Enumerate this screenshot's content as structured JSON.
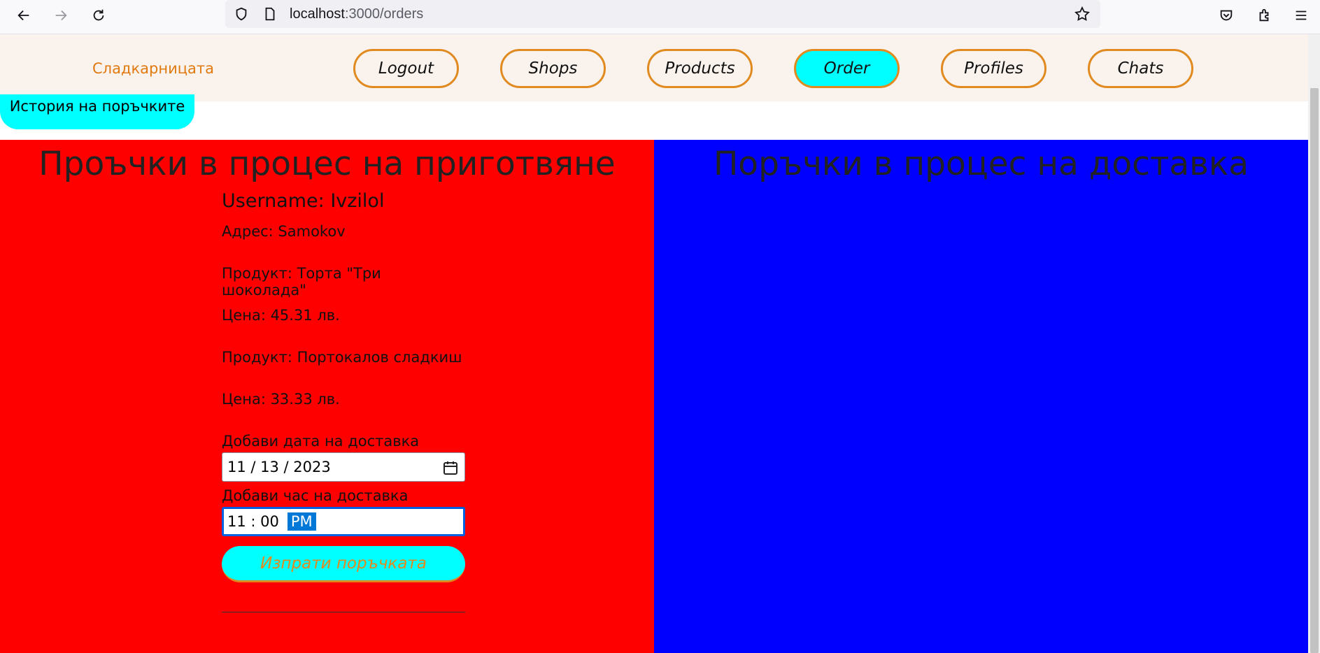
{
  "browser": {
    "url_host": "localhost",
    "url_path": ":3000/orders"
  },
  "nav": {
    "brand": "Сладкарницата",
    "buttons": [
      "Logout",
      "Shops",
      "Products",
      "Order",
      "Profiles",
      "Chats"
    ],
    "active": "Order"
  },
  "history_button": "История на поръчките",
  "left_panel": {
    "title": "Проъчки в процес на приготвяне",
    "order": {
      "username": "Username: Ivzilol",
      "address": "Адрес: Samokov",
      "product1": "Продукт: Торта \"Три шоколада\"",
      "price1": "Цена: 45.31 лв.",
      "product2": "Продукт: Портокалов сладкиш",
      "price2": "Цена: 33.33 лв.",
      "date_label": "Добави дата на доставка",
      "date_value": "11 / 13 / 2023",
      "time_label": "Добави час на доставка",
      "time_value": "11 : 00",
      "time_ampm": "PM",
      "send_button": "Изпрати поръчката"
    }
  },
  "right_panel": {
    "title": "Поръчки в процес на доставка"
  },
  "colors": {
    "left_bg": "#ff0000",
    "right_bg": "#0000ff",
    "accent": "#00ffff",
    "brand": "#e07a10"
  }
}
